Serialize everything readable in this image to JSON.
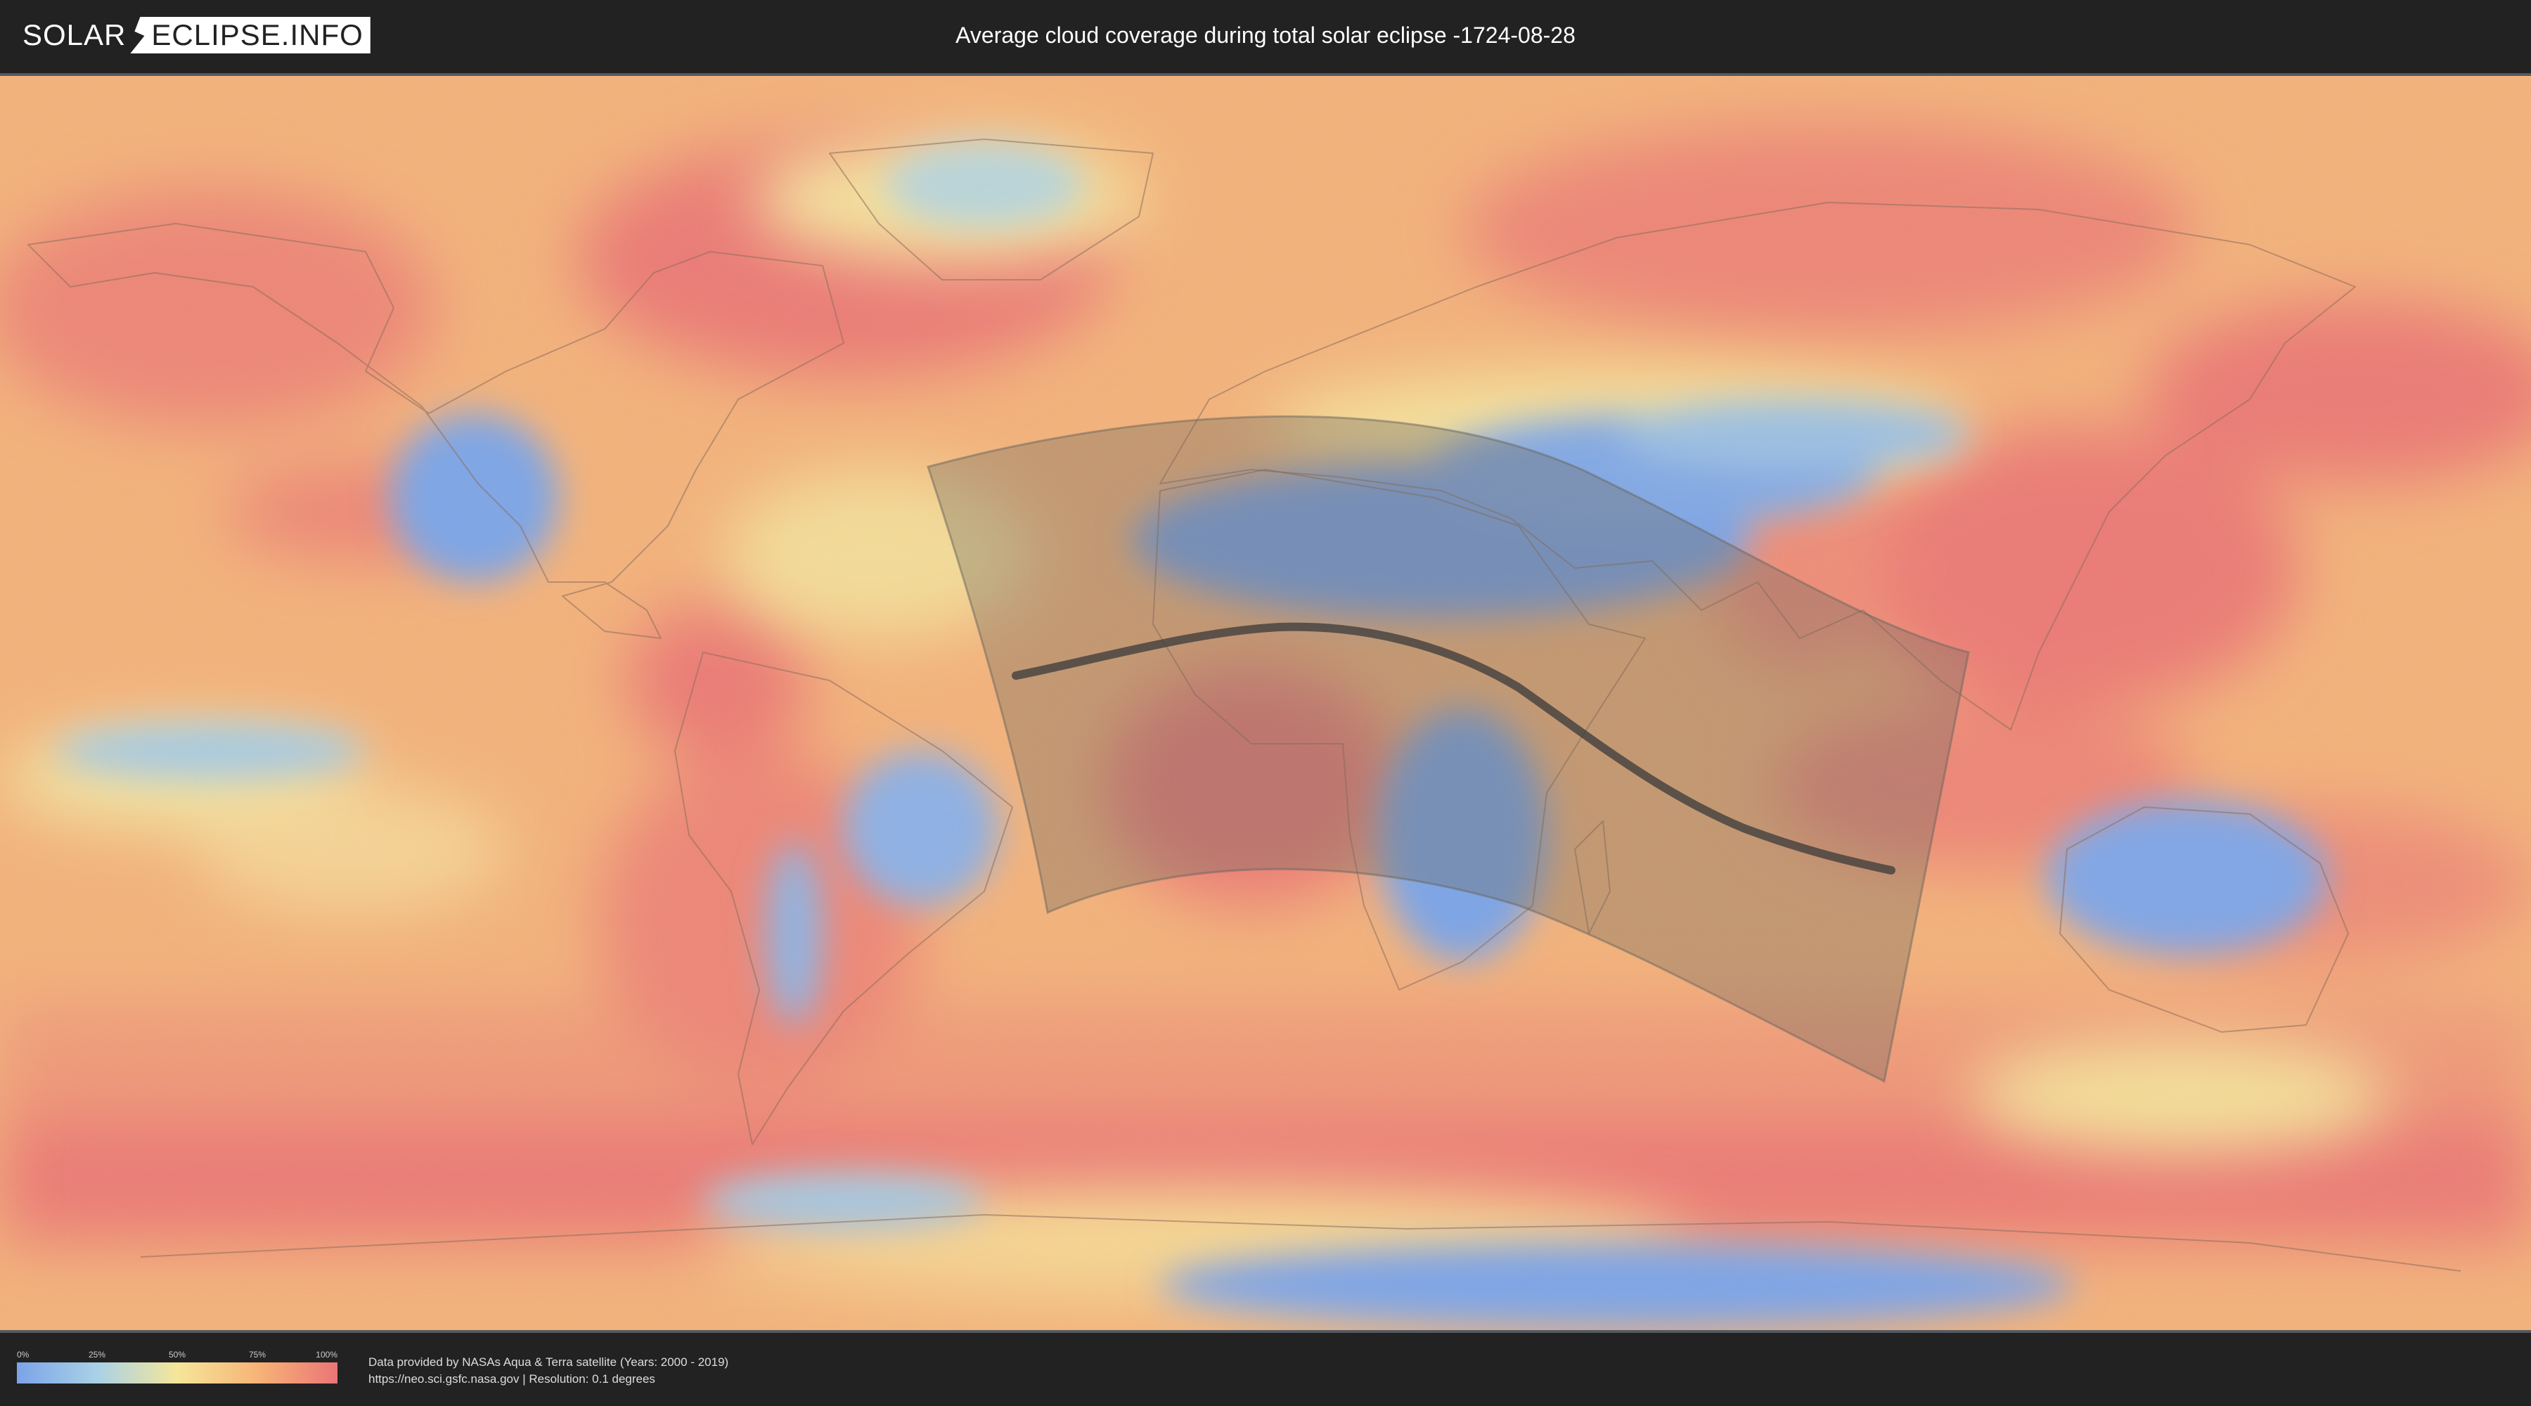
{
  "header": {
    "logo_part1": "SOLAR",
    "logo_part2": "ECLIPSE.INFO",
    "title": "Average cloud coverage during total solar eclipse -1724-08-28"
  },
  "legend": {
    "ticks": [
      "0%",
      "25%",
      "50%",
      "75%",
      "100%"
    ],
    "colors": {
      "0": "#7ba4e8",
      "25": "#a9d1e6",
      "50": "#f5e69a",
      "75": "#f7b477",
      "100": "#eb7575"
    }
  },
  "footer": {
    "credit_line1": "Data provided by NASAs Aqua & Terra satellite (Years: 2000 - 2019)",
    "credit_line2": "https://neo.sci.gsfc.nasa.gov | Resolution: 0.1 degrees"
  },
  "map": {
    "projection": "equirectangular",
    "eclipse_shadow_region": "semi-transparent gray band over Atlantic, Africa and Indian Ocean",
    "central_line_color": "#3a3a3a"
  }
}
